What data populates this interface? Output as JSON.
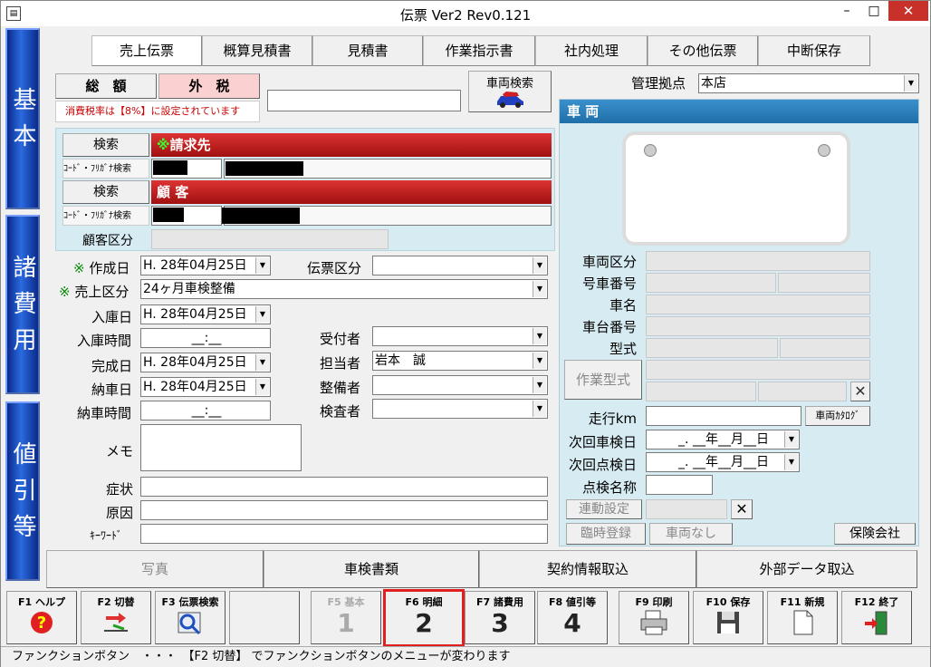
{
  "window": {
    "title": "伝票 Ver2 Rev0.121",
    "minimize": "–",
    "maximize": "□",
    "close": "✕",
    "app_icon": "document-icon"
  },
  "side_tabs": [
    "基本",
    "諸費用",
    "値引等"
  ],
  "tabs": [
    "売上伝票",
    "概算見積書",
    "見積書",
    "作業指示書",
    "社内処理",
    "その他伝票",
    "中断保存"
  ],
  "total": {
    "label": "総　額",
    "tax_label": "外　税",
    "tax_note": "消費税率は【8%】に設定されています"
  },
  "vehicle_search": {
    "label": "車両検索",
    "icon": "car-icon"
  },
  "branch": {
    "label": "管理拠点",
    "value": "本店"
  },
  "billing": {
    "search_label": "検索",
    "title_mark": "※",
    "title": "請求先",
    "code_label": "ｺｰﾄﾞ・ﾌﾘｶﾞﾅ検索"
  },
  "customer": {
    "search_label": "検索",
    "title": "顧 客",
    "code_label": "ｺｰﾄﾞ・ﾌﾘｶﾞﾅ検索",
    "class_label": "顧客区分"
  },
  "form": {
    "created_label": "作成日",
    "created_value": "H. 28年04月25日",
    "slip_class_label": "伝票区分",
    "sales_class_label": "売上区分",
    "sales_class_value": "24ヶ月車検整備",
    "entry_date_label": "入庫日",
    "entry_date_value": "H. 28年04月25日",
    "entry_time_label": "入庫時間",
    "entry_time_value": "__:__",
    "receiver_label": "受付者",
    "done_date_label": "完成日",
    "done_date_value": "H. 28年04月25日",
    "staff_label": "担当者",
    "staff_value": "岩本　誠",
    "delivery_date_label": "納車日",
    "delivery_date_value": "H. 28年04月25日",
    "mechanic_label": "整備者",
    "delivery_time_label": "納車時間",
    "delivery_time_value": "__:__",
    "inspector_label": "検査者",
    "memo_label": "メモ",
    "symptom_label": "症状",
    "cause_label": "原因",
    "keyword_label": "ｷｰﾜｰﾄﾞ",
    "required_mark": "※"
  },
  "vehicle": {
    "header": "車 両",
    "type_label": "車両区分",
    "number_label": "号車番号",
    "name_label": "車名",
    "chassis_label": "車台番号",
    "model_label": "型式",
    "work_model_button": "作業型式",
    "mileage_label": "走行km",
    "catalog_button": "車両ｶﾀﾛｸﾞ",
    "next_inspection_label": "次回車検日",
    "next_inspection_value": "_. __年__月__日",
    "next_check_label": "次回点検日",
    "next_check_value": "_. __年__月__日",
    "check_name_label": "点検名称",
    "link_settings_button": "連動設定",
    "temp_register_button": "臨時登録",
    "no_vehicle_button": "車両なし",
    "insurance_button": "保険会社",
    "clear_icon": "close-x-icon"
  },
  "bottom_tabs": [
    "写真",
    "車検書類",
    "契約情報取込",
    "外部データ取込"
  ],
  "fkeys": [
    {
      "key": "F1 ヘルプ",
      "icon": "help-icon",
      "num": ""
    },
    {
      "key": "F2 切替",
      "icon": "switch-icon",
      "num": ""
    },
    {
      "key": "F3 伝票検索",
      "icon": "search-icon",
      "num": ""
    },
    {
      "key": "",
      "icon": "",
      "num": ""
    },
    {
      "key": "F5 基本",
      "icon": "",
      "num": "1"
    },
    {
      "key": "F6 明細",
      "icon": "",
      "num": "2"
    },
    {
      "key": "F7 諸費用",
      "icon": "",
      "num": "3"
    },
    {
      "key": "F8 値引等",
      "icon": "",
      "num": "4"
    },
    {
      "key": "F9 印刷",
      "icon": "printer-icon",
      "num": ""
    },
    {
      "key": "F10 保存",
      "icon": "floppy-icon",
      "num": ""
    },
    {
      "key": "F11 新規",
      "icon": "new-doc-icon",
      "num": ""
    },
    {
      "key": "F12 終了",
      "icon": "exit-icon",
      "num": ""
    }
  ],
  "status": "ファンクションボタン　・・・　【F2 切替】 でファンクションボタンのメニューが変わります",
  "colors": {
    "side_tab": "#1a4ad0",
    "red_bar": "#c0201a",
    "panel": "#d7ecf2",
    "vehicle_header": "#2c7fb8",
    "highlight": "#e02020"
  }
}
